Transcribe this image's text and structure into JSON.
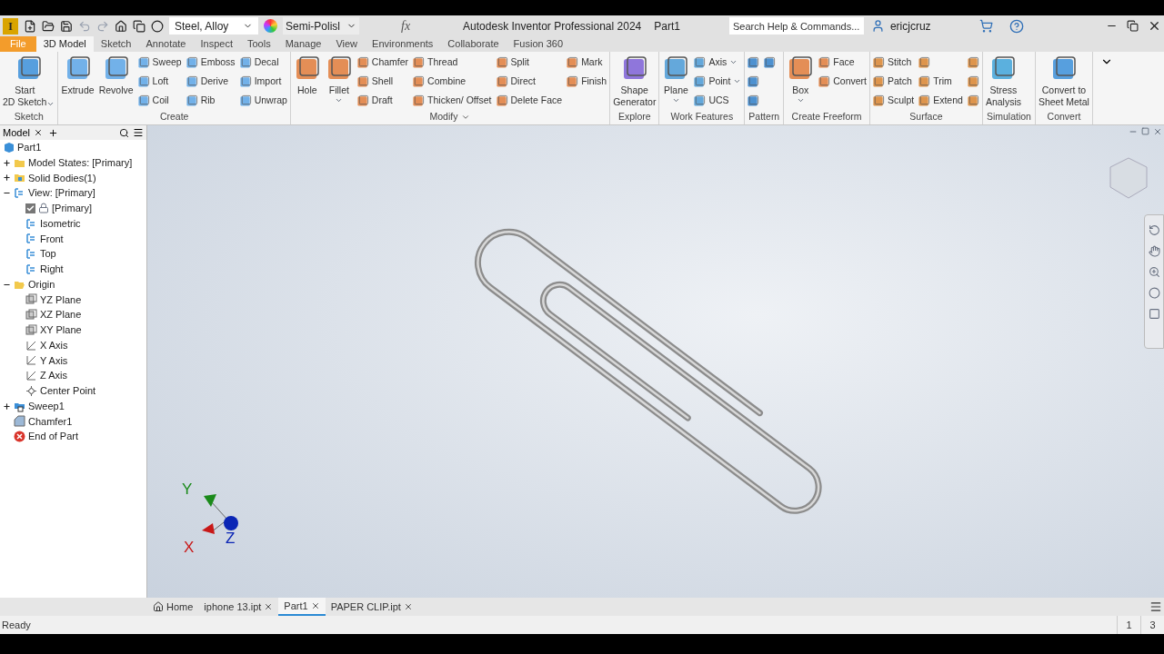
{
  "app": {
    "logo": "I",
    "title": "Autodesk Inventor Professional 2024",
    "document": "Part1"
  },
  "quick_access": {
    "material": "Steel, Alloy",
    "appearance": "Semi-Polisl",
    "formula": "fx"
  },
  "search": {
    "placeholder": "Search Help & Commands..."
  },
  "user": {
    "name": "ericjcruz"
  },
  "tabs": [
    {
      "label": "File",
      "kind": "app_menu",
      "selected": false
    },
    {
      "label": "3D Model",
      "kind": "tab",
      "selected": true
    },
    {
      "label": "Sketch",
      "kind": "tab",
      "selected": false
    },
    {
      "label": "Annotate",
      "kind": "tab",
      "selected": false
    },
    {
      "label": "Inspect",
      "kind": "tab",
      "selected": false
    },
    {
      "label": "Tools",
      "kind": "tab",
      "selected": false
    },
    {
      "label": "Manage",
      "kind": "tab",
      "selected": false
    },
    {
      "label": "View",
      "kind": "tab",
      "selected": false
    },
    {
      "label": "Environments",
      "kind": "tab",
      "selected": false
    },
    {
      "label": "Collaborate",
      "kind": "tab",
      "selected": false
    },
    {
      "label": "Fusion 360",
      "kind": "tab",
      "selected": false
    }
  ],
  "ribbon": [
    {
      "title": "Sketch",
      "items": [
        {
          "kind": "large",
          "label": "Start\n2D Sketch",
          "dropdown": true
        }
      ]
    },
    {
      "title": "Create",
      "items": [
        {
          "kind": "large",
          "label": "Extrude"
        },
        {
          "kind": "large",
          "label": "Revolve"
        },
        {
          "kind": "column",
          "tools": [
            {
              "label": "Sweep"
            },
            {
              "label": "Loft"
            },
            {
              "label": "Coil"
            }
          ]
        },
        {
          "kind": "column",
          "tools": [
            {
              "label": "Emboss"
            },
            {
              "label": "Derive"
            },
            {
              "label": "Rib"
            }
          ]
        },
        {
          "kind": "column",
          "tools": [
            {
              "label": "Decal"
            },
            {
              "label": "Import"
            },
            {
              "label": "Unwrap"
            }
          ]
        }
      ]
    },
    {
      "title": "Modify",
      "menu": true,
      "items": [
        {
          "kind": "large",
          "label": "Hole"
        },
        {
          "kind": "large",
          "label": "Fillet",
          "dropdown": true
        },
        {
          "kind": "column",
          "tools": [
            {
              "label": "Chamfer"
            },
            {
              "label": "Shell"
            },
            {
              "label": "Draft"
            }
          ]
        },
        {
          "kind": "column",
          "tools": [
            {
              "label": "Thread"
            },
            {
              "label": "Combine"
            },
            {
              "label": "Thicken/ Offset"
            }
          ]
        },
        {
          "kind": "column",
          "tools": [
            {
              "label": "Split"
            },
            {
              "label": "Direct"
            },
            {
              "label": "Delete Face"
            }
          ]
        },
        {
          "kind": "column",
          "tools": [
            {
              "label": "Mark"
            },
            {
              "label": "Finish"
            }
          ]
        }
      ]
    },
    {
      "title": "Explore",
      "items": [
        {
          "kind": "large",
          "label": "Shape\nGenerator"
        }
      ]
    },
    {
      "title": "Work Features",
      "items": [
        {
          "kind": "large",
          "label": "Plane",
          "dropdown": true
        },
        {
          "kind": "column",
          "tools": [
            {
              "label": "Axis",
              "dropdown": true
            },
            {
              "label": "Point",
              "dropdown": true
            },
            {
              "label": "UCS"
            }
          ]
        }
      ]
    },
    {
      "title": "Pattern",
      "items": [
        {
          "kind": "column",
          "tools": [
            {
              "kind": "icon"
            },
            {
              "kind": "icon"
            },
            {
              "kind": "icon"
            }
          ]
        },
        {
          "kind": "column",
          "tools": [
            {
              "kind": "icon"
            }
          ]
        }
      ]
    },
    {
      "title": "Create Freeform",
      "items": [
        {
          "kind": "large",
          "label": "Box",
          "dropdown": true
        },
        {
          "kind": "column",
          "tools": [
            {
              "label": "Face"
            },
            {
              "label": "Convert"
            }
          ]
        }
      ]
    },
    {
      "title": "Surface",
      "items": [
        {
          "kind": "column",
          "tools": [
            {
              "label": "Stitch"
            },
            {
              "label": "Patch"
            },
            {
              "label": "Sculpt"
            }
          ]
        },
        {
          "kind": "column",
          "tools": [
            {
              "kind": "icon"
            },
            {
              "kind": "text",
              "label": "Trim"
            },
            {
              "kind": "text",
              "label": "Extend"
            }
          ]
        },
        {
          "kind": "column",
          "tools": [
            {
              "kind": "icon"
            },
            {
              "kind": "icon"
            },
            {
              "kind": "icon"
            }
          ]
        }
      ]
    },
    {
      "title": "Simulation",
      "items": [
        {
          "kind": "large",
          "label": "Stress\nAnalysis"
        }
      ]
    },
    {
      "title": "Convert",
      "items": [
        {
          "kind": "large",
          "label": "Convert to\nSheet Metal"
        }
      ]
    }
  ],
  "browser": {
    "tab": "Model",
    "tree": {
      "label": "Part1",
      "kind": "part",
      "children": [
        {
          "label": "Model States: [Primary]",
          "kind": "folder",
          "expanded": false
        },
        {
          "label": "Solid Bodies(1)",
          "kind": "bodies",
          "expanded": false
        },
        {
          "label": "View: [Primary]",
          "kind": "view",
          "expanded": true,
          "children": [
            {
              "label": "[Primary]",
              "kind": "locked_view",
              "checked": true
            },
            {
              "label": "Isometric",
              "kind": "view"
            },
            {
              "label": "Front",
              "kind": "view"
            },
            {
              "label": "Top",
              "kind": "view"
            },
            {
              "label": "Right",
              "kind": "view"
            }
          ]
        },
        {
          "label": "Origin",
          "kind": "open_folder",
          "expanded": true,
          "children": [
            {
              "label": "YZ Plane",
              "kind": "plane"
            },
            {
              "label": "XZ Plane",
              "kind": "plane"
            },
            {
              "label": "XY Plane",
              "kind": "plane"
            },
            {
              "label": "X Axis",
              "kind": "axis"
            },
            {
              "label": "Y Axis",
              "kind": "axis"
            },
            {
              "label": "Z Axis",
              "kind": "axis"
            },
            {
              "label": "Center Point",
              "kind": "point"
            }
          ]
        },
        {
          "label": "Sweep1",
          "kind": "sweep",
          "expanded": false
        },
        {
          "label": "Chamfer1",
          "kind": "chamfer"
        },
        {
          "label": "End of Part",
          "kind": "end"
        }
      ]
    }
  },
  "viewport": {
    "triad": {
      "y": "Y",
      "x": "X",
      "z": "Z"
    }
  },
  "document_tabs": [
    {
      "label": "Home",
      "kind": "home",
      "selected": false
    },
    {
      "label": "iphone 13.ipt",
      "kind": "doc",
      "selected": false
    },
    {
      "label": "Part1",
      "kind": "doc",
      "selected": true
    },
    {
      "label": "PAPER CLIP.ipt",
      "kind": "doc",
      "selected": false
    }
  ],
  "status_bar": {
    "message": "Ready",
    "cells": [
      "1",
      "3"
    ]
  }
}
